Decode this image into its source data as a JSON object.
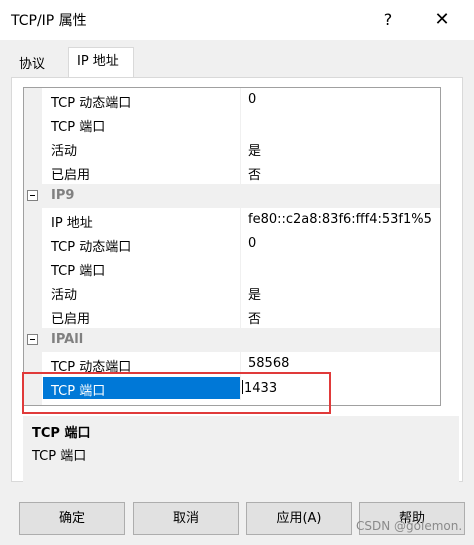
{
  "window": {
    "title": "TCP/IP 属性",
    "help_glyph": "?",
    "close_glyph": "✕"
  },
  "tabs": [
    {
      "label": "协议"
    },
    {
      "label": "IP 地址"
    }
  ],
  "grid": {
    "rows_top": [
      {
        "name": "TCP 动态端口",
        "value": "0"
      },
      {
        "name": "TCP 端口",
        "value": ""
      },
      {
        "name": "活动",
        "value": "是"
      },
      {
        "name": "已启用",
        "value": "否"
      }
    ],
    "ip9": {
      "label": "IP9",
      "rows": [
        {
          "name": "IP 地址",
          "value": "fe80::c2a8:83f6:fff4:53f1%5"
        },
        {
          "name": "TCP 动态端口",
          "value": "0"
        },
        {
          "name": "TCP 端口",
          "value": ""
        },
        {
          "name": "活动",
          "value": "是"
        },
        {
          "name": "已启用",
          "value": "否"
        }
      ]
    },
    "ipall": {
      "label": "IPAll",
      "rows": [
        {
          "name": "TCP 动态端口",
          "value": "58568"
        },
        {
          "name": "TCP 端口",
          "value": "1433"
        }
      ]
    },
    "scroll_up_glyph": "▲",
    "scroll_down_glyph": "▼"
  },
  "description": {
    "title": "TCP 端口",
    "text": "TCP 端口"
  },
  "buttons": {
    "ok": "确定",
    "cancel": "取消",
    "apply": "应用(A)",
    "help": "帮助"
  },
  "watermark": "CSDN @golemon."
}
